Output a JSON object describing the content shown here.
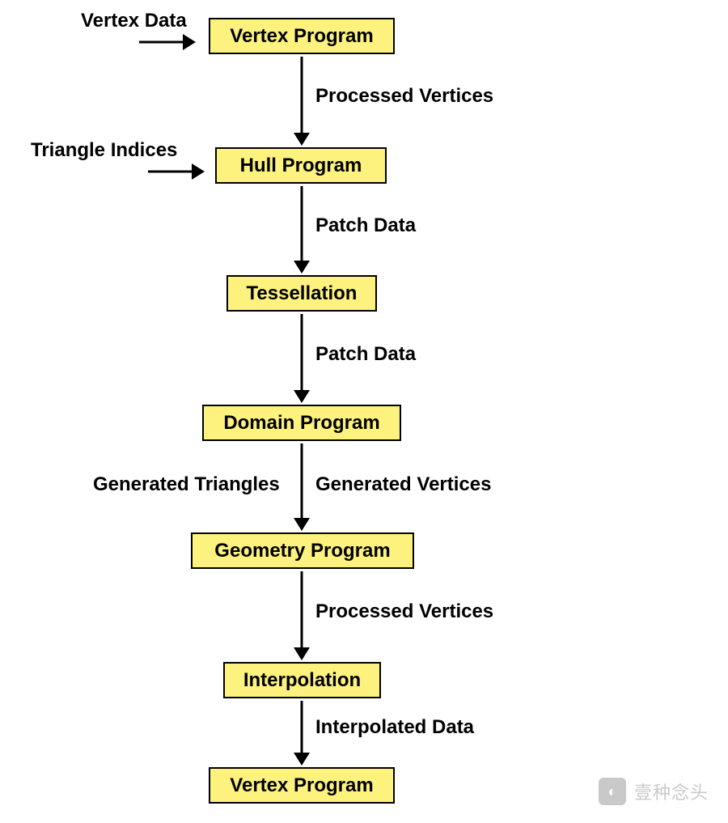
{
  "stages": {
    "s1": "Vertex Program",
    "s2": "Hull Program",
    "s3": "Tessellation",
    "s4": "Domain Program",
    "s5": "Geometry Program",
    "s6": "Interpolation",
    "s7": "Vertex Program"
  },
  "inputs": {
    "vertex_data": "Vertex Data",
    "triangle_indices": "Triangle Indices"
  },
  "edges": {
    "e1": "Processed Vertices",
    "e2": "Patch Data",
    "e3": "Patch Data",
    "e4l": "Generated Triangles",
    "e4r": "Generated Vertices",
    "e5": "Processed Vertices",
    "e6": "Interpolated Data"
  },
  "watermark": {
    "text": "壹种念头",
    "icon": "◐"
  }
}
